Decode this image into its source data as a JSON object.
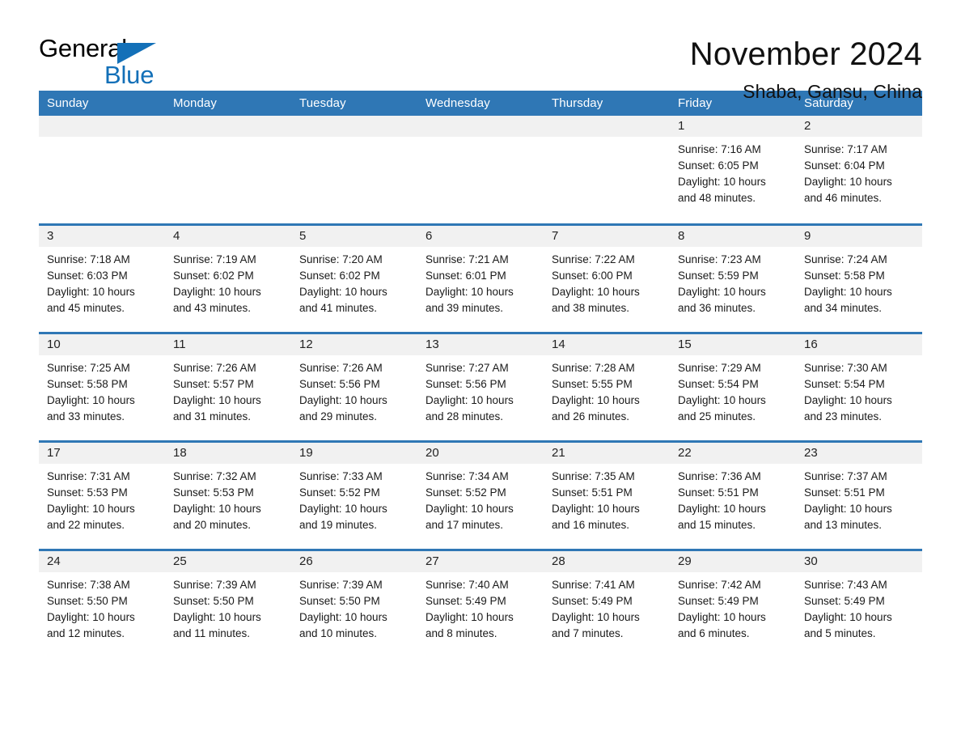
{
  "logo": {
    "word_one": "General",
    "word_two": "Blue",
    "triangle_color": "#1370b8"
  },
  "header": {
    "title": "November 2024",
    "location": "Shaba, Gansu, China"
  },
  "theme": {
    "header_blue": "#2f77b5",
    "daynum_band": "#f1f1f1",
    "text": "#1a1a1a"
  },
  "calendar": {
    "weekday_headers": [
      "Sunday",
      "Monday",
      "Tuesday",
      "Wednesday",
      "Thursday",
      "Friday",
      "Saturday"
    ],
    "weeks": [
      [
        {
          "day": "",
          "sunrise": "",
          "sunset": "",
          "daylight_line1": "",
          "daylight_line2": ""
        },
        {
          "day": "",
          "sunrise": "",
          "sunset": "",
          "daylight_line1": "",
          "daylight_line2": ""
        },
        {
          "day": "",
          "sunrise": "",
          "sunset": "",
          "daylight_line1": "",
          "daylight_line2": ""
        },
        {
          "day": "",
          "sunrise": "",
          "sunset": "",
          "daylight_line1": "",
          "daylight_line2": ""
        },
        {
          "day": "",
          "sunrise": "",
          "sunset": "",
          "daylight_line1": "",
          "daylight_line2": ""
        },
        {
          "day": "1",
          "sunrise": "Sunrise: 7:16 AM",
          "sunset": "Sunset: 6:05 PM",
          "daylight_line1": "Daylight: 10 hours",
          "daylight_line2": "and 48 minutes."
        },
        {
          "day": "2",
          "sunrise": "Sunrise: 7:17 AM",
          "sunset": "Sunset: 6:04 PM",
          "daylight_line1": "Daylight: 10 hours",
          "daylight_line2": "and 46 minutes."
        }
      ],
      [
        {
          "day": "3",
          "sunrise": "Sunrise: 7:18 AM",
          "sunset": "Sunset: 6:03 PM",
          "daylight_line1": "Daylight: 10 hours",
          "daylight_line2": "and 45 minutes."
        },
        {
          "day": "4",
          "sunrise": "Sunrise: 7:19 AM",
          "sunset": "Sunset: 6:02 PM",
          "daylight_line1": "Daylight: 10 hours",
          "daylight_line2": "and 43 minutes."
        },
        {
          "day": "5",
          "sunrise": "Sunrise: 7:20 AM",
          "sunset": "Sunset: 6:02 PM",
          "daylight_line1": "Daylight: 10 hours",
          "daylight_line2": "and 41 minutes."
        },
        {
          "day": "6",
          "sunrise": "Sunrise: 7:21 AM",
          "sunset": "Sunset: 6:01 PM",
          "daylight_line1": "Daylight: 10 hours",
          "daylight_line2": "and 39 minutes."
        },
        {
          "day": "7",
          "sunrise": "Sunrise: 7:22 AM",
          "sunset": "Sunset: 6:00 PM",
          "daylight_line1": "Daylight: 10 hours",
          "daylight_line2": "and 38 minutes."
        },
        {
          "day": "8",
          "sunrise": "Sunrise: 7:23 AM",
          "sunset": "Sunset: 5:59 PM",
          "daylight_line1": "Daylight: 10 hours",
          "daylight_line2": "and 36 minutes."
        },
        {
          "day": "9",
          "sunrise": "Sunrise: 7:24 AM",
          "sunset": "Sunset: 5:58 PM",
          "daylight_line1": "Daylight: 10 hours",
          "daylight_line2": "and 34 minutes."
        }
      ],
      [
        {
          "day": "10",
          "sunrise": "Sunrise: 7:25 AM",
          "sunset": "Sunset: 5:58 PM",
          "daylight_line1": "Daylight: 10 hours",
          "daylight_line2": "and 33 minutes."
        },
        {
          "day": "11",
          "sunrise": "Sunrise: 7:26 AM",
          "sunset": "Sunset: 5:57 PM",
          "daylight_line1": "Daylight: 10 hours",
          "daylight_line2": "and 31 minutes."
        },
        {
          "day": "12",
          "sunrise": "Sunrise: 7:26 AM",
          "sunset": "Sunset: 5:56 PM",
          "daylight_line1": "Daylight: 10 hours",
          "daylight_line2": "and 29 minutes."
        },
        {
          "day": "13",
          "sunrise": "Sunrise: 7:27 AM",
          "sunset": "Sunset: 5:56 PM",
          "daylight_line1": "Daylight: 10 hours",
          "daylight_line2": "and 28 minutes."
        },
        {
          "day": "14",
          "sunrise": "Sunrise: 7:28 AM",
          "sunset": "Sunset: 5:55 PM",
          "daylight_line1": "Daylight: 10 hours",
          "daylight_line2": "and 26 minutes."
        },
        {
          "day": "15",
          "sunrise": "Sunrise: 7:29 AM",
          "sunset": "Sunset: 5:54 PM",
          "daylight_line1": "Daylight: 10 hours",
          "daylight_line2": "and 25 minutes."
        },
        {
          "day": "16",
          "sunrise": "Sunrise: 7:30 AM",
          "sunset": "Sunset: 5:54 PM",
          "daylight_line1": "Daylight: 10 hours",
          "daylight_line2": "and 23 minutes."
        }
      ],
      [
        {
          "day": "17",
          "sunrise": "Sunrise: 7:31 AM",
          "sunset": "Sunset: 5:53 PM",
          "daylight_line1": "Daylight: 10 hours",
          "daylight_line2": "and 22 minutes."
        },
        {
          "day": "18",
          "sunrise": "Sunrise: 7:32 AM",
          "sunset": "Sunset: 5:53 PM",
          "daylight_line1": "Daylight: 10 hours",
          "daylight_line2": "and 20 minutes."
        },
        {
          "day": "19",
          "sunrise": "Sunrise: 7:33 AM",
          "sunset": "Sunset: 5:52 PM",
          "daylight_line1": "Daylight: 10 hours",
          "daylight_line2": "and 19 minutes."
        },
        {
          "day": "20",
          "sunrise": "Sunrise: 7:34 AM",
          "sunset": "Sunset: 5:52 PM",
          "daylight_line1": "Daylight: 10 hours",
          "daylight_line2": "and 17 minutes."
        },
        {
          "day": "21",
          "sunrise": "Sunrise: 7:35 AM",
          "sunset": "Sunset: 5:51 PM",
          "daylight_line1": "Daylight: 10 hours",
          "daylight_line2": "and 16 minutes."
        },
        {
          "day": "22",
          "sunrise": "Sunrise: 7:36 AM",
          "sunset": "Sunset: 5:51 PM",
          "daylight_line1": "Daylight: 10 hours",
          "daylight_line2": "and 15 minutes."
        },
        {
          "day": "23",
          "sunrise": "Sunrise: 7:37 AM",
          "sunset": "Sunset: 5:51 PM",
          "daylight_line1": "Daylight: 10 hours",
          "daylight_line2": "and 13 minutes."
        }
      ],
      [
        {
          "day": "24",
          "sunrise": "Sunrise: 7:38 AM",
          "sunset": "Sunset: 5:50 PM",
          "daylight_line1": "Daylight: 10 hours",
          "daylight_line2": "and 12 minutes."
        },
        {
          "day": "25",
          "sunrise": "Sunrise: 7:39 AM",
          "sunset": "Sunset: 5:50 PM",
          "daylight_line1": "Daylight: 10 hours",
          "daylight_line2": "and 11 minutes."
        },
        {
          "day": "26",
          "sunrise": "Sunrise: 7:39 AM",
          "sunset": "Sunset: 5:50 PM",
          "daylight_line1": "Daylight: 10 hours",
          "daylight_line2": "and 10 minutes."
        },
        {
          "day": "27",
          "sunrise": "Sunrise: 7:40 AM",
          "sunset": "Sunset: 5:49 PM",
          "daylight_line1": "Daylight: 10 hours",
          "daylight_line2": "and 8 minutes."
        },
        {
          "day": "28",
          "sunrise": "Sunrise: 7:41 AM",
          "sunset": "Sunset: 5:49 PM",
          "daylight_line1": "Daylight: 10 hours",
          "daylight_line2": "and 7 minutes."
        },
        {
          "day": "29",
          "sunrise": "Sunrise: 7:42 AM",
          "sunset": "Sunset: 5:49 PM",
          "daylight_line1": "Daylight: 10 hours",
          "daylight_line2": "and 6 minutes."
        },
        {
          "day": "30",
          "sunrise": "Sunrise: 7:43 AM",
          "sunset": "Sunset: 5:49 PM",
          "daylight_line1": "Daylight: 10 hours",
          "daylight_line2": "and 5 minutes."
        }
      ]
    ]
  }
}
